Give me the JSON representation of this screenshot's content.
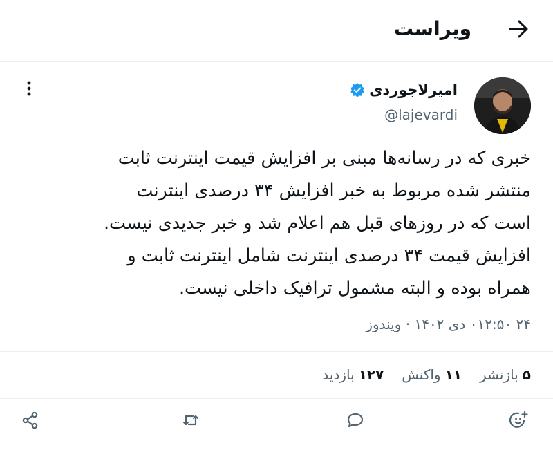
{
  "header": {
    "title": "ویراست",
    "back_icon": "arrow-right-icon"
  },
  "author": {
    "name": "امیرلاجوردی",
    "handle": "@lajevardi",
    "verified_color": "#1d9bf0"
  },
  "post": {
    "text": "خبری که در رسانه‌ها مبنی بر افزایش قیمت اینترنت ثابت\nمنتشر شده مربوط به خبر افزایش ۳۴ درصدی اینترنت\nاست که در روزهای قبل هم اعلام شد و خبر جدیدی نیست.\nافزایش قیمت ۳۴ درصدی اینترنت شامل اینترنت ثابت و\nهمراه بوده و البته مشمول ترافیک داخلی نیست.",
    "meta": "۲۴ ۰۱۲:۵۰ دی ۱۴۰۲ · ویندوز"
  },
  "stats": {
    "reposts_num": "۵",
    "reposts_label": "بازنشر",
    "reactions_num": "۱۱",
    "reactions_label": "واکنش",
    "views_num": "۱۲۷",
    "views_label": "بازدید"
  },
  "colors": {
    "text": "#0f1419",
    "secondary": "#536471",
    "divider": "#eceff1"
  },
  "actions": [
    "emoji-reaction-icon",
    "reply-icon",
    "repost-icon",
    "share-icon"
  ]
}
